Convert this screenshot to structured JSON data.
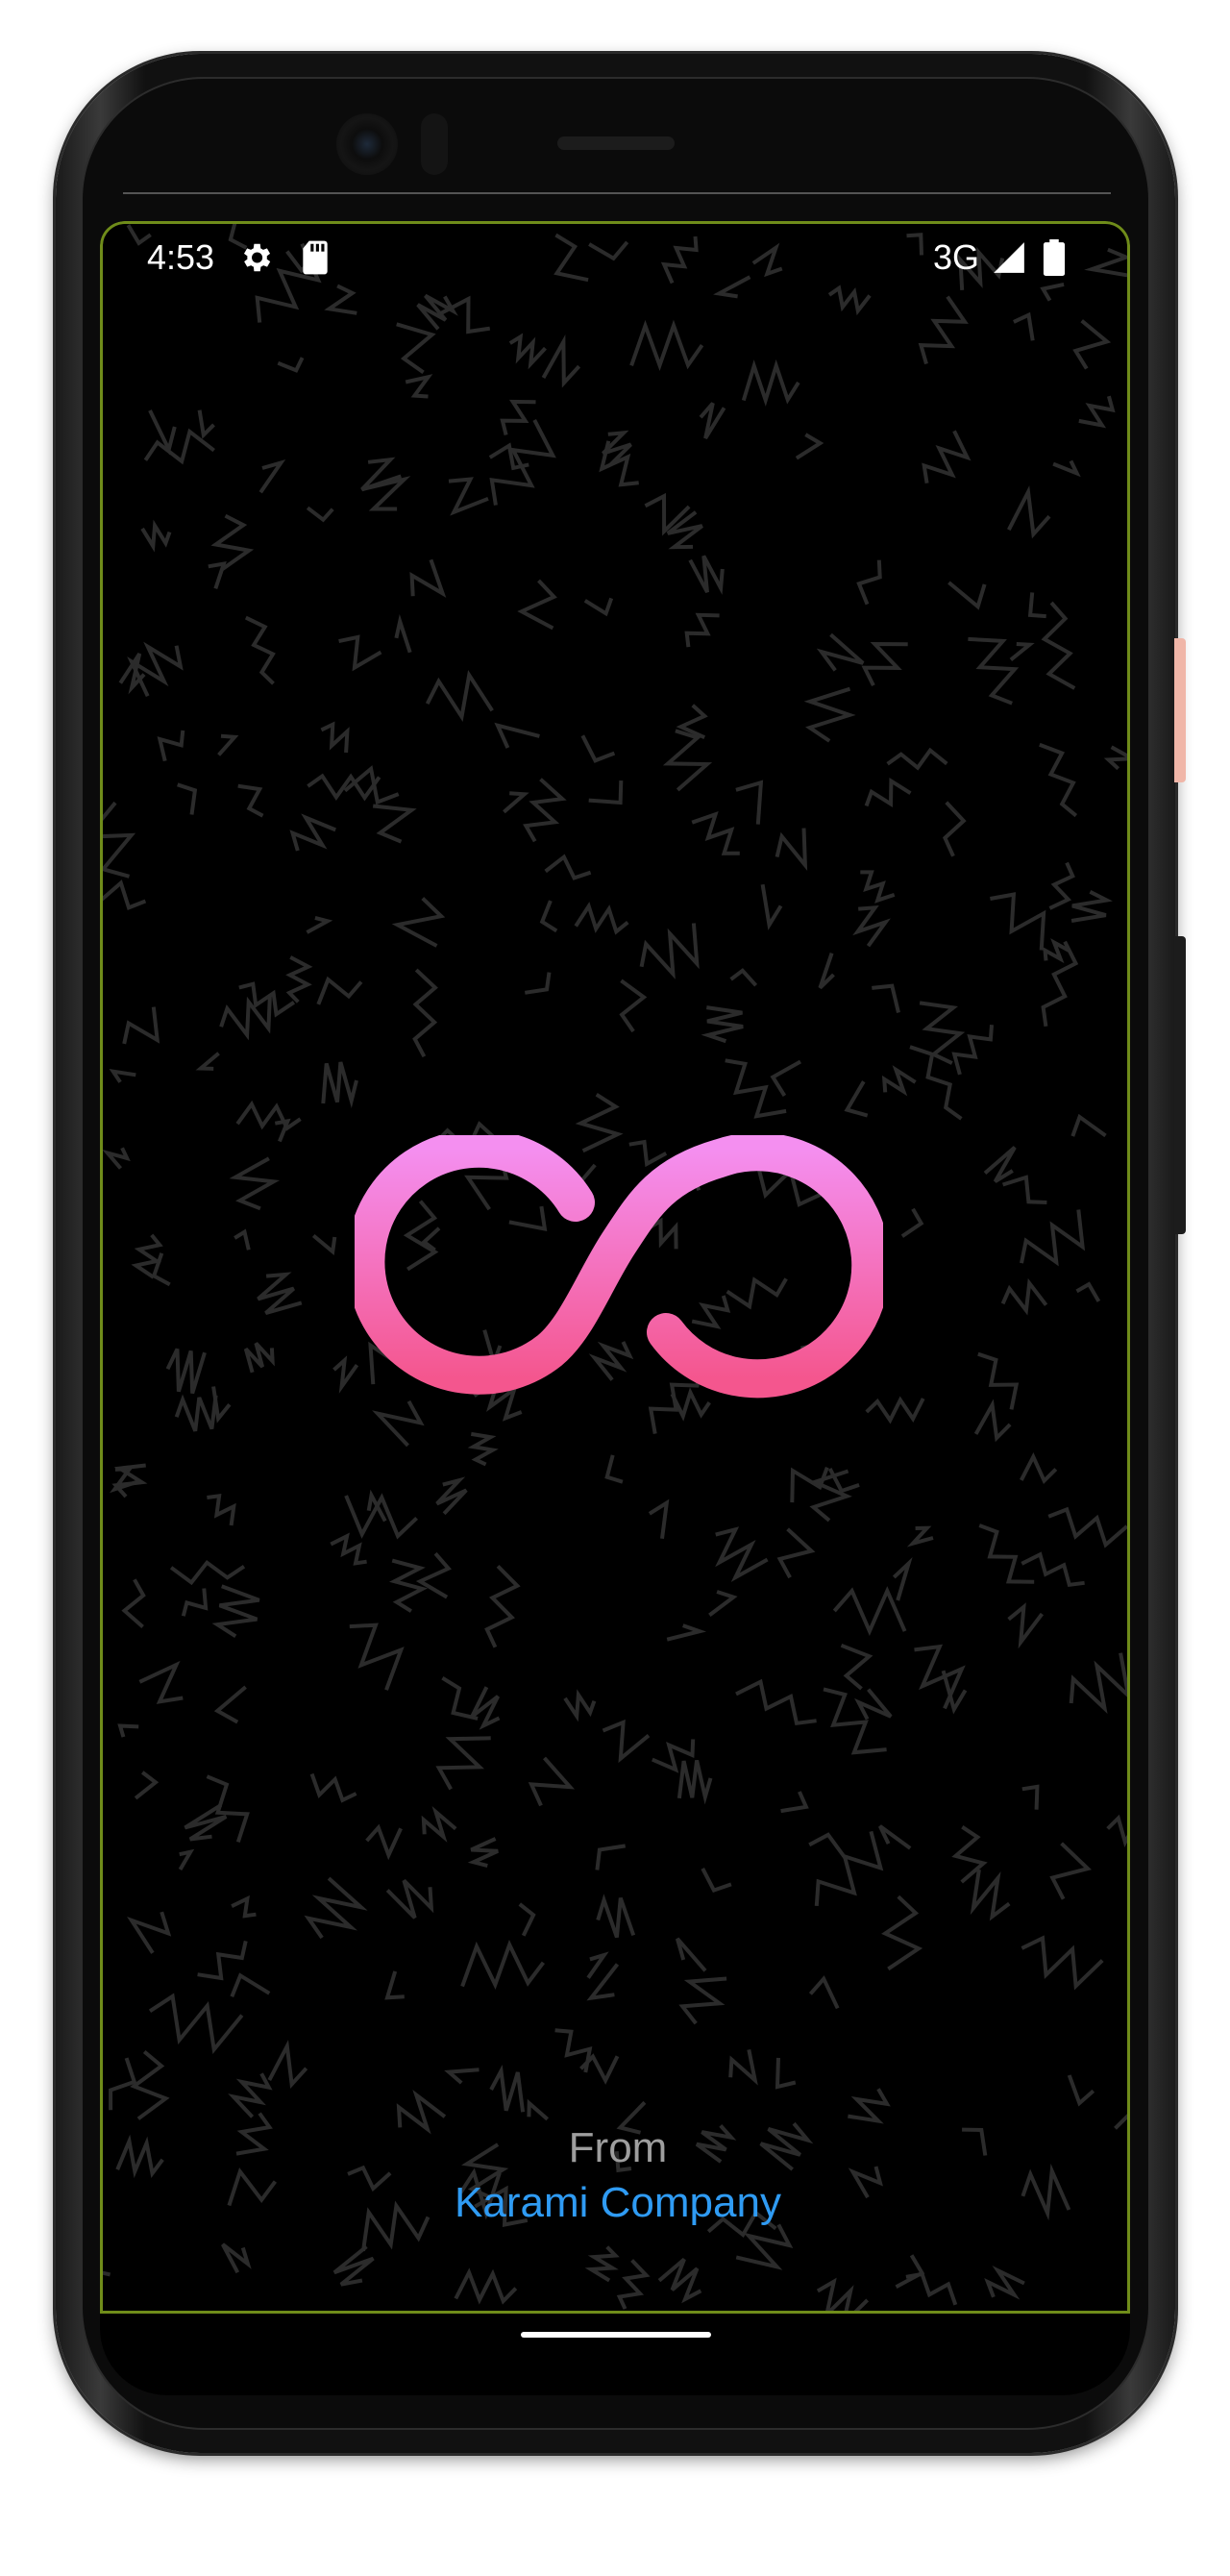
{
  "status_bar": {
    "time": "4:53",
    "network": "3G",
    "icons": [
      "gear-icon",
      "sd-card-icon",
      "signal-icon",
      "battery-icon"
    ]
  },
  "splash": {
    "logo": "infinity-logo-icon",
    "logo_gradient": [
      "#f48ff0",
      "#f4568e"
    ],
    "background": "#000000",
    "pattern_color": "#2b2b2b"
  },
  "credit": {
    "prefix": "From",
    "company": "Karami Company",
    "prefix_color": "#9e9e9e",
    "company_color": "#2f9bf3"
  }
}
